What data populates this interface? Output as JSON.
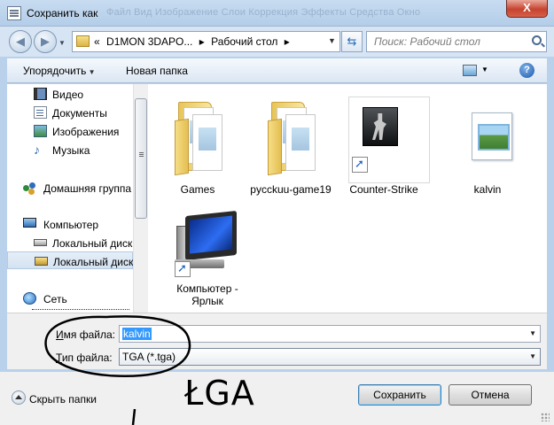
{
  "window": {
    "title": "Сохранить как",
    "background_menu": "Файл   Вид   Изображение   Слои   Коррекция   Эффекты   Средства   Окно",
    "close_symbol": "X"
  },
  "address": {
    "prefix": "«",
    "crumbs": [
      "D1MON 3DAPO...",
      "Рабочий стол"
    ],
    "separator": "▸",
    "search_placeholder": "Поиск: Рабочий стол"
  },
  "toolbar": {
    "organize_label": "Упорядочить",
    "new_folder_label": "Новая папка",
    "help_symbol": "?"
  },
  "nav": {
    "items": [
      {
        "label": "Видео",
        "icon": "video-icon"
      },
      {
        "label": "Документы",
        "icon": "documents-icon"
      },
      {
        "label": "Изображения",
        "icon": "images-icon"
      },
      {
        "label": "Музыка",
        "icon": "music-icon"
      },
      {
        "label": "Домашняя группа",
        "icon": "homegroup-icon"
      },
      {
        "label": "Компьютер",
        "icon": "computer-icon"
      },
      {
        "label": "Локальный диск",
        "icon": "drive-icon"
      },
      {
        "label": "Локальный диск",
        "icon": "drive-icon",
        "selected": true
      },
      {
        "label": "Сеть",
        "icon": "network-icon"
      }
    ]
  },
  "files": [
    {
      "name": "Games",
      "icon": "folder-icon"
    },
    {
      "name": "pycckuu-game19",
      "icon": "folder-icon"
    },
    {
      "name": "Counter-Strike",
      "icon": "counter-strike-icon",
      "shortcut": true
    },
    {
      "name": "kalvin",
      "icon": "image-file-icon"
    },
    {
      "name": "Компьютер - Ярлык",
      "icon": "computer-icon",
      "shortcut": true
    }
  ],
  "form": {
    "filename_label_underlined": "И",
    "filename_label_rest": "мя файла:",
    "filename_value": "kalvin",
    "filetype_label_underlined": "Т",
    "filetype_label_rest": "ип файла:",
    "filetype_value": "TGA (*.tga)"
  },
  "footer": {
    "hide_folders_label": "Скрыть папки",
    "save_label": "Сохранить",
    "cancel_label": "Отмена"
  },
  "annotation": {
    "handwritten_text": "ŁGA"
  },
  "colors": {
    "frame": "#b9d1ea",
    "selection": "#3399ff",
    "close": "#c7432e"
  }
}
